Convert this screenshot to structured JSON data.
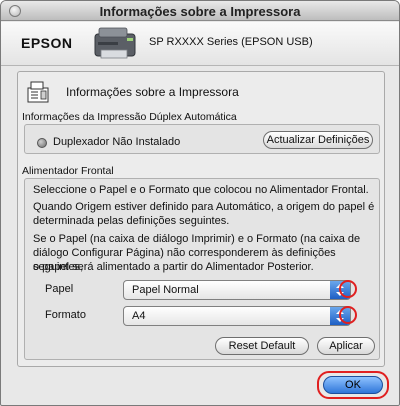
{
  "window": {
    "title": "Informações sobre a Impressora"
  },
  "header": {
    "brand": "EPSON",
    "printer_name": "SP RXXXX Series (EPSON USB)"
  },
  "panel": {
    "heading": "Informações sobre a Impressora",
    "duplex": {
      "group_label": "Informações da Impressão Dúplex Automática",
      "status": "Duplexador Não Instalado",
      "update_button": "Actualizar Definições"
    },
    "front_feeder": {
      "group_label": "Alimentador Frontal",
      "lines": [
        "Seleccione o Papel e o Formato que colocou no Alimentador Frontal.",
        "Quando Origem estiver definido para Automático, a origem do papel é",
        "determinada pelas definições seguintes.",
        "Se o Papel (na caixa de diálogo Imprimir) e o Formato (na caixa de",
        "diálogo Configurar Página) não corresponderem às definições seguintes,",
        "o papel será alimentado a partir do Alimentador Posterior."
      ],
      "paper_label": "Papel",
      "paper_value": "Papel Normal",
      "size_label": "Formato",
      "size_value": "A4",
      "reset_button": "Reset Default",
      "apply_button": "Aplicar"
    }
  },
  "footer": {
    "ok_button": "OK"
  },
  "colors": {
    "highlight": "#e02020",
    "accent": "#2f76d9"
  }
}
